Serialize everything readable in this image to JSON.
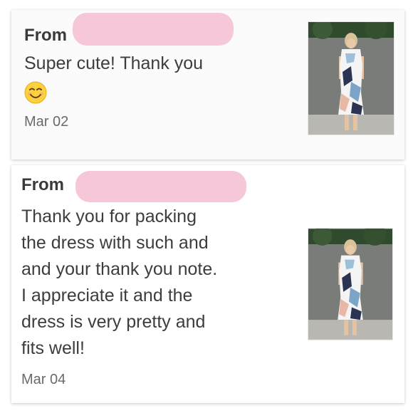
{
  "reviews": [
    {
      "from_label": "From",
      "message": "Super cute! Thank you",
      "emoji": "smiling-face-icon",
      "date": "Mar 02",
      "thumbnail": "product-photo-dress"
    },
    {
      "from_label": "From",
      "message": "Thank you for packing\nthe dress with such and\nand your thank you note.\nI appreciate it and the\ndress is very pretty and\nfits well!",
      "date": "Mar 04",
      "thumbnail": "product-photo-dress"
    }
  ],
  "colors": {
    "redaction": "#f6c7d8",
    "text": "#3d3d3d",
    "date": "#6a6a6a"
  }
}
